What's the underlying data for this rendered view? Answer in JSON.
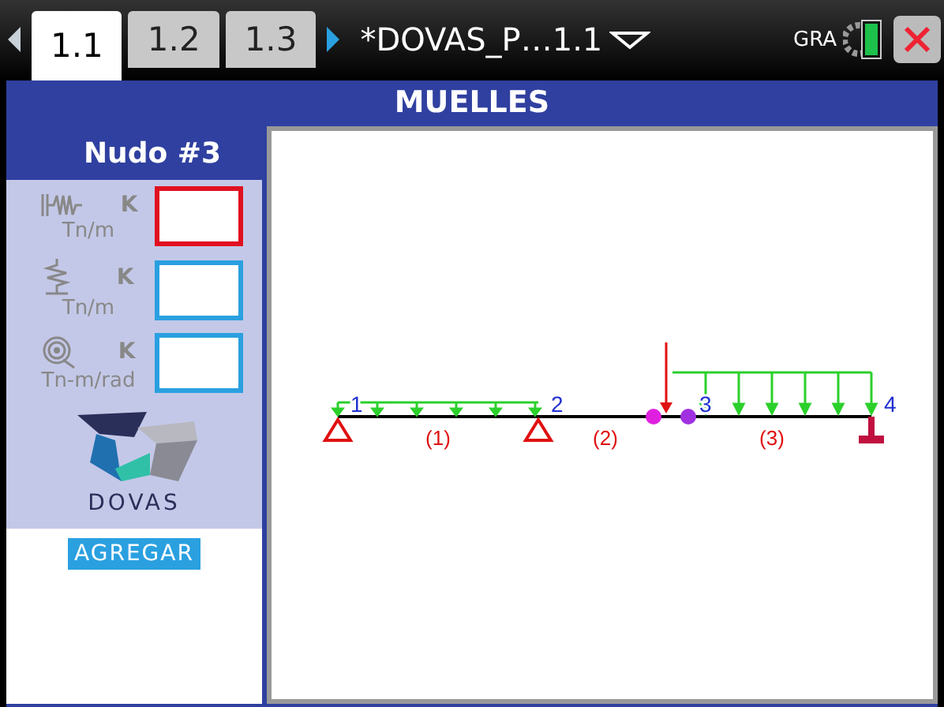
{
  "tabs": [
    {
      "label": "1.1",
      "selected": true
    },
    {
      "label": "1.2",
      "selected": false
    },
    {
      "label": "1.3",
      "selected": false
    }
  ],
  "document_title": "*DOVAS_P…1.1",
  "status": "GRA",
  "header": "MUELLES",
  "panel": {
    "title": "Nudo #3",
    "springs": [
      {
        "kind": "axial",
        "symbol": "K",
        "unit": "Tn/m",
        "focused": true
      },
      {
        "kind": "vertical",
        "symbol": "K",
        "unit": "Tn/m",
        "focused": false
      },
      {
        "kind": "rotational",
        "symbol": "K",
        "unit": "Tn-m/rad",
        "focused": false
      }
    ],
    "logo_text": "DOVAS",
    "button": "AGREGAR"
  },
  "diagram": {
    "nodes": [
      {
        "label": "1",
        "kind": "pin"
      },
      {
        "label": "2",
        "kind": "pin"
      },
      {
        "label": "3",
        "kind": "hinge"
      },
      {
        "label": "4",
        "kind": "fixed"
      }
    ],
    "elements": [
      "(1)",
      "(2)",
      "(3)"
    ]
  }
}
